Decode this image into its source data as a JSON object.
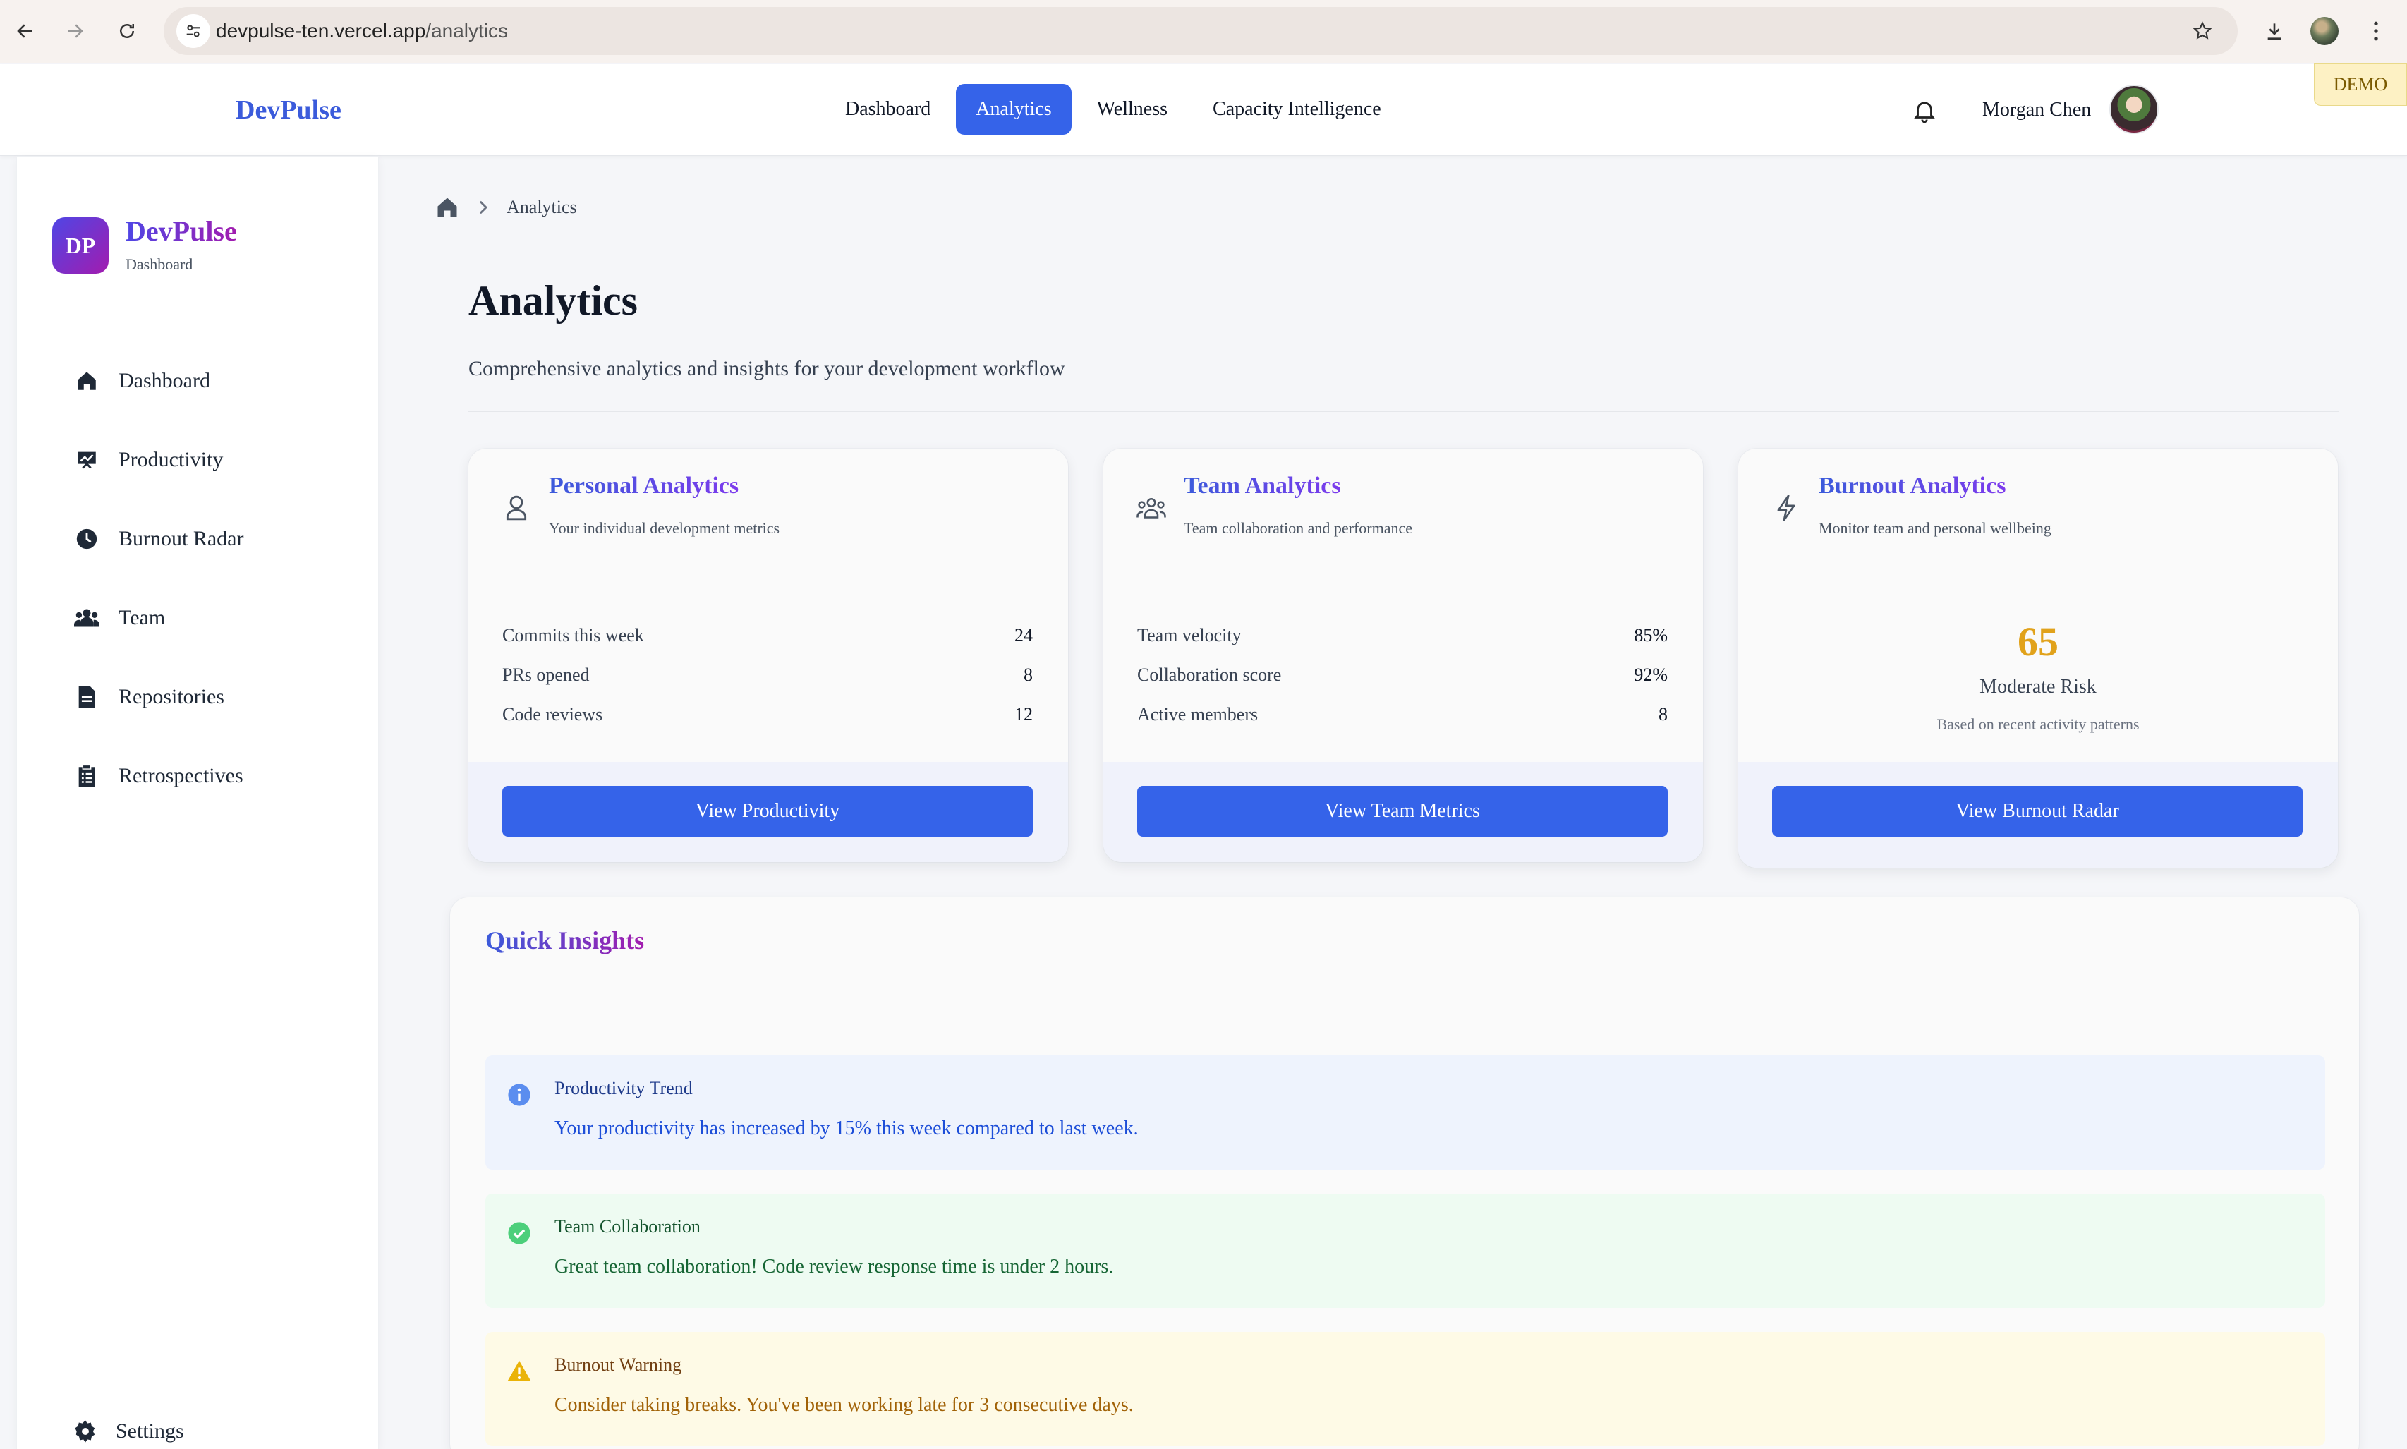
{
  "browser": {
    "url_host": "devpulse-ten.vercel.app",
    "url_path": "/analytics"
  },
  "appbar": {
    "brand": "DevPulse",
    "nav": [
      {
        "label": "Dashboard",
        "active": false
      },
      {
        "label": "Analytics",
        "active": true
      },
      {
        "label": "Wellness",
        "active": false
      },
      {
        "label": "Capacity Intelligence",
        "active": false
      }
    ],
    "user_name": "Morgan Chen",
    "demo_badge": "DEMO"
  },
  "sidebar": {
    "logo_initials": "DP",
    "brand": "DevPulse",
    "subtitle": "Dashboard",
    "items": [
      {
        "label": "Dashboard",
        "icon": "home-icon"
      },
      {
        "label": "Productivity",
        "icon": "presentation-chart-icon"
      },
      {
        "label": "Burnout Radar",
        "icon": "clock-icon"
      },
      {
        "label": "Team",
        "icon": "people-icon"
      },
      {
        "label": "Repositories",
        "icon": "document-icon"
      },
      {
        "label": "Retrospectives",
        "icon": "clipboard-icon"
      }
    ],
    "settings_label": "Settings"
  },
  "breadcrumb": {
    "current": "Analytics"
  },
  "page": {
    "title": "Analytics",
    "subtitle": "Comprehensive analytics and insights for your development workflow"
  },
  "cards": {
    "personal": {
      "title": "Personal Analytics",
      "subtitle": "Your individual development metrics",
      "metrics": [
        {
          "label": "Commits this week",
          "value": "24"
        },
        {
          "label": "PRs opened",
          "value": "8"
        },
        {
          "label": "Code reviews",
          "value": "12"
        }
      ],
      "button": "View Productivity"
    },
    "team": {
      "title": "Team Analytics",
      "subtitle": "Team collaboration and performance",
      "metrics": [
        {
          "label": "Team velocity",
          "value": "85%"
        },
        {
          "label": "Collaboration score",
          "value": "92%"
        },
        {
          "label": "Active members",
          "value": "8"
        }
      ],
      "button": "View Team Metrics"
    },
    "burnout": {
      "title": "Burnout Analytics",
      "subtitle": "Monitor team and personal wellbeing",
      "score": "65",
      "risk_label": "Moderate Risk",
      "note": "Based on recent activity patterns",
      "button": "View Burnout Radar"
    }
  },
  "insights": {
    "title": "Quick Insights",
    "alerts": [
      {
        "type": "info",
        "title": "Productivity Trend",
        "message": "Your productivity has increased by 15% this week compared to last week."
      },
      {
        "type": "success",
        "title": "Team Collaboration",
        "message": "Great team collaboration! Code review response time is under 2 hours."
      },
      {
        "type": "warning",
        "title": "Burnout Warning",
        "message": "Consider taking breaks. You've been working late for 3 consecutive days."
      }
    ]
  },
  "colors": {
    "accent": "#3563e9",
    "brand": "#3b5bdb",
    "risk_score": "#e1a21b"
  }
}
